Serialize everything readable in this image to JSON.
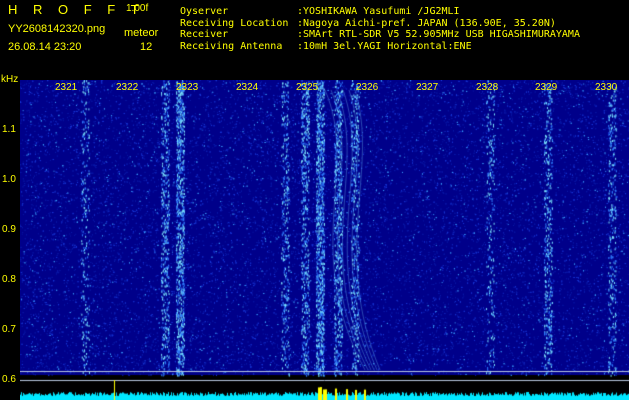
{
  "header": {
    "brand": "H R O F F T",
    "version": "1.00f",
    "filename": "YY2608142320.png",
    "meteor_label": "meteor",
    "datetime": "26.08.14 23:20",
    "meteor_count": "12"
  },
  "info": [
    {
      "key": "Oyserver",
      "value": ":YOSHIKAWA Yasufumi /JG2MLI"
    },
    {
      "key": "Receiving Location",
      "value": ":Nagoya Aichi-pref. JAPAN (136.90E, 35.20N)"
    },
    {
      "key": "Receiver",
      "value": ":SMArt RTL-SDR V5 52.905MHz USB HIGASHIMURAYAMA"
    },
    {
      "key": "Receiving Antenna",
      "value": ":10mH 3el.YAGI Horizontal:ENE"
    }
  ],
  "axis": {
    "y_unit": "kHz",
    "y_ticks": [
      "1.1",
      "1.0",
      "0.9",
      "0.8",
      "0.7",
      "0.6"
    ],
    "x_ticks": [
      "2321",
      "2322",
      "2323",
      "2324",
      "2325",
      "2326",
      "2327",
      "2328",
      "2329",
      "2330"
    ]
  },
  "colors": {
    "text": "#ffff00",
    "background": "#000000",
    "spectrogram_base": "#00008a",
    "noise_level": "#00e8ff",
    "marker": "#ffff00"
  }
}
